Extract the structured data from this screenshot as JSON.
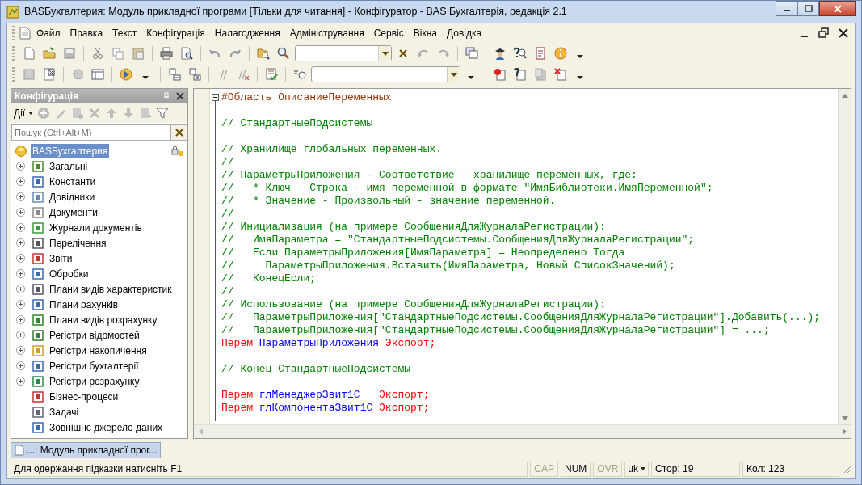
{
  "window": {
    "title": "BASБухгалтерия: Модуль прикладної програми [Тільки для читання] - Конфігуратор - BAS Бухгалтерія, редакція 2.1"
  },
  "menu": [
    {
      "label": "Файл"
    },
    {
      "label": "Правка"
    },
    {
      "label": "Текст"
    },
    {
      "label": "Конфігурація"
    },
    {
      "label": "Налагодження"
    },
    {
      "label": "Адміністрування"
    },
    {
      "label": "Сервіс"
    },
    {
      "label": "Вікна"
    },
    {
      "label": "Довідка"
    }
  ],
  "config_panel": {
    "title": "Конфігурація",
    "actions_label": "Дії",
    "search": {
      "placeholder": "Пошук (Ctrl+Alt+M)"
    },
    "tree": [
      {
        "label": "BASБухгалтерия",
        "selected": true,
        "children": [
          {
            "label": "Загальні",
            "selected": false,
            "expandable": true
          },
          {
            "label": "Константи",
            "selected": false,
            "expandable": true
          },
          {
            "label": "Довідники",
            "selected": false,
            "expandable": true
          },
          {
            "label": "Документи",
            "selected": false,
            "expandable": true
          },
          {
            "label": "Журнали документів",
            "selected": false,
            "expandable": true
          },
          {
            "label": "Перелічення",
            "selected": false,
            "expandable": true
          },
          {
            "label": "Звіти",
            "selected": false,
            "expandable": true
          },
          {
            "label": "Обробки",
            "selected": false,
            "expandable": true
          },
          {
            "label": "Плани видів характеристик",
            "selected": false,
            "expandable": true
          },
          {
            "label": "Плани рахунків",
            "selected": false,
            "expandable": true
          },
          {
            "label": "Плани видів розрахунку",
            "selected": false,
            "expandable": true
          },
          {
            "label": "Регістри відомостей",
            "selected": false,
            "expandable": true
          },
          {
            "label": "Регістри накопичення",
            "selected": false,
            "expandable": true
          },
          {
            "label": "Регістри бухгалтерії",
            "selected": false,
            "expandable": true
          },
          {
            "label": "Регістри розрахунку",
            "selected": false,
            "expandable": true
          },
          {
            "label": "Бізнес-процеси",
            "selected": false,
            "expandable": false
          },
          {
            "label": "Задачі",
            "selected": false,
            "expandable": false
          },
          {
            "label": "Зовнішнє джерело даних",
            "selected": false,
            "expandable": false
          }
        ]
      }
    ]
  },
  "editor": {
    "lines": [
      {
        "kind": "code",
        "fold": true,
        "segments": [
          {
            "kind": "region",
            "text": "#Область ОписаниеПеременных"
          }
        ]
      },
      {
        "kind": "blank"
      },
      {
        "kind": "code",
        "segments": [
          {
            "kind": "comment",
            "text": "// СтандартныеПодсистемы"
          }
        ]
      },
      {
        "kind": "blank"
      },
      {
        "kind": "code",
        "segments": [
          {
            "kind": "comment",
            "text": "// Хранилище глобальных переменных."
          }
        ]
      },
      {
        "kind": "code",
        "segments": [
          {
            "kind": "comment",
            "text": "//"
          }
        ]
      },
      {
        "kind": "code",
        "segments": [
          {
            "kind": "comment",
            "text": "// ПараметрыПриложения - Соответствие - хранилище переменных, где:"
          }
        ]
      },
      {
        "kind": "code",
        "segments": [
          {
            "kind": "comment",
            "text": "//   * Ключ - Строка - имя переменной в формате \"ИмяБиблиотеки.ИмяПеременной\";"
          }
        ]
      },
      {
        "kind": "code",
        "segments": [
          {
            "kind": "comment",
            "text": "//   * Значение - Произвольный - значение переменной."
          }
        ]
      },
      {
        "kind": "code",
        "segments": [
          {
            "kind": "comment",
            "text": "//"
          }
        ]
      },
      {
        "kind": "code",
        "segments": [
          {
            "kind": "comment",
            "text": "// Инициализация (на примере СообщенияДляЖурналаРегистрации):"
          }
        ]
      },
      {
        "kind": "code",
        "segments": [
          {
            "kind": "comment",
            "text": "//   ИмяПараметра = \"СтандартныеПодсистемы.СообщенияДляЖурналаРегистрации\";"
          }
        ]
      },
      {
        "kind": "code",
        "segments": [
          {
            "kind": "comment",
            "text": "//   Если ПараметрыПриложения[ИмяПараметра] = Неопределено Тогда"
          }
        ]
      },
      {
        "kind": "code",
        "segments": [
          {
            "kind": "comment",
            "text": "//     ПараметрыПриложения.Вставить(ИмяПараметра, Новый СписокЗначений);"
          }
        ]
      },
      {
        "kind": "code",
        "segments": [
          {
            "kind": "comment",
            "text": "//   КонецЕсли;"
          }
        ]
      },
      {
        "kind": "code",
        "segments": [
          {
            "kind": "comment",
            "text": "//"
          }
        ]
      },
      {
        "kind": "code",
        "segments": [
          {
            "kind": "comment",
            "text": "// Использование (на примере СообщенияДляЖурналаРегистрации):"
          }
        ]
      },
      {
        "kind": "code",
        "segments": [
          {
            "kind": "comment",
            "text": "//   ПараметрыПриложения[\"СтандартныеПодсистемы.СообщенияДляЖурналаРегистрации\"].Добавить(...);"
          }
        ]
      },
      {
        "kind": "code",
        "segments": [
          {
            "kind": "comment",
            "text": "//   ПараметрыПриложения[\"СтандартныеПодсистемы.СообщенияДляЖурналаРегистрации\"] = ...;"
          }
        ]
      },
      {
        "kind": "code",
        "segments": [
          {
            "kind": "keyword",
            "text": "Перем"
          },
          {
            "kind": "ident",
            "text": " ПараметрыПриложения "
          },
          {
            "kind": "keyword",
            "text": "Экспорт;"
          }
        ]
      },
      {
        "kind": "blank"
      },
      {
        "kind": "code",
        "segments": [
          {
            "kind": "comment",
            "text": "// Конец СтандартныеПодсистемы"
          }
        ]
      },
      {
        "kind": "blank"
      },
      {
        "kind": "code",
        "segments": [
          {
            "kind": "keyword",
            "text": "Перем"
          },
          {
            "kind": "ident",
            "text": " глМенеджерЗвит1С   "
          },
          {
            "kind": "keyword",
            "text": "Экспорт;"
          }
        ]
      },
      {
        "kind": "code",
        "segments": [
          {
            "kind": "keyword",
            "text": "Перем"
          },
          {
            "kind": "ident",
            "text": " глКомпонентаЗвит1С "
          },
          {
            "kind": "keyword",
            "text": "Экспорт;"
          }
        ]
      }
    ]
  },
  "window_tabs": [
    {
      "label": "...: Модуль прикладної прог...",
      "selected": true
    }
  ],
  "status_bar": {
    "hint": "Для одержання підказки натисніть F1",
    "indicators": [
      {
        "label": "CAP",
        "on": false
      },
      {
        "label": "NUM",
        "on": true
      },
      {
        "label": "OVR",
        "on": false
      }
    ],
    "language": "uk",
    "row": "Стор: 19",
    "column": "Кол: 123"
  }
}
